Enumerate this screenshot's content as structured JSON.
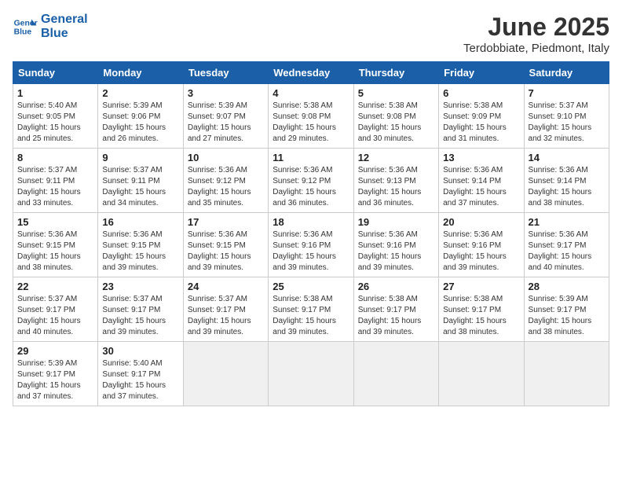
{
  "logo": {
    "line1": "General",
    "line2": "Blue"
  },
  "title": "June 2025",
  "subtitle": "Terdobbiate, Piedmont, Italy",
  "headers": [
    "Sunday",
    "Monday",
    "Tuesday",
    "Wednesday",
    "Thursday",
    "Friday",
    "Saturday"
  ],
  "weeks": [
    [
      {
        "day": "1",
        "sunrise": "Sunrise: 5:40 AM",
        "sunset": "Sunset: 9:05 PM",
        "daylight": "Daylight: 15 hours and 25 minutes."
      },
      {
        "day": "2",
        "sunrise": "Sunrise: 5:39 AM",
        "sunset": "Sunset: 9:06 PM",
        "daylight": "Daylight: 15 hours and 26 minutes."
      },
      {
        "day": "3",
        "sunrise": "Sunrise: 5:39 AM",
        "sunset": "Sunset: 9:07 PM",
        "daylight": "Daylight: 15 hours and 27 minutes."
      },
      {
        "day": "4",
        "sunrise": "Sunrise: 5:38 AM",
        "sunset": "Sunset: 9:08 PM",
        "daylight": "Daylight: 15 hours and 29 minutes."
      },
      {
        "day": "5",
        "sunrise": "Sunrise: 5:38 AM",
        "sunset": "Sunset: 9:08 PM",
        "daylight": "Daylight: 15 hours and 30 minutes."
      },
      {
        "day": "6",
        "sunrise": "Sunrise: 5:38 AM",
        "sunset": "Sunset: 9:09 PM",
        "daylight": "Daylight: 15 hours and 31 minutes."
      },
      {
        "day": "7",
        "sunrise": "Sunrise: 5:37 AM",
        "sunset": "Sunset: 9:10 PM",
        "daylight": "Daylight: 15 hours and 32 minutes."
      }
    ],
    [
      {
        "day": "8",
        "sunrise": "Sunrise: 5:37 AM",
        "sunset": "Sunset: 9:11 PM",
        "daylight": "Daylight: 15 hours and 33 minutes."
      },
      {
        "day": "9",
        "sunrise": "Sunrise: 5:37 AM",
        "sunset": "Sunset: 9:11 PM",
        "daylight": "Daylight: 15 hours and 34 minutes."
      },
      {
        "day": "10",
        "sunrise": "Sunrise: 5:36 AM",
        "sunset": "Sunset: 9:12 PM",
        "daylight": "Daylight: 15 hours and 35 minutes."
      },
      {
        "day": "11",
        "sunrise": "Sunrise: 5:36 AM",
        "sunset": "Sunset: 9:12 PM",
        "daylight": "Daylight: 15 hours and 36 minutes."
      },
      {
        "day": "12",
        "sunrise": "Sunrise: 5:36 AM",
        "sunset": "Sunset: 9:13 PM",
        "daylight": "Daylight: 15 hours and 36 minutes."
      },
      {
        "day": "13",
        "sunrise": "Sunrise: 5:36 AM",
        "sunset": "Sunset: 9:14 PM",
        "daylight": "Daylight: 15 hours and 37 minutes."
      },
      {
        "day": "14",
        "sunrise": "Sunrise: 5:36 AM",
        "sunset": "Sunset: 9:14 PM",
        "daylight": "Daylight: 15 hours and 38 minutes."
      }
    ],
    [
      {
        "day": "15",
        "sunrise": "Sunrise: 5:36 AM",
        "sunset": "Sunset: 9:15 PM",
        "daylight": "Daylight: 15 hours and 38 minutes."
      },
      {
        "day": "16",
        "sunrise": "Sunrise: 5:36 AM",
        "sunset": "Sunset: 9:15 PM",
        "daylight": "Daylight: 15 hours and 39 minutes."
      },
      {
        "day": "17",
        "sunrise": "Sunrise: 5:36 AM",
        "sunset": "Sunset: 9:15 PM",
        "daylight": "Daylight: 15 hours and 39 minutes."
      },
      {
        "day": "18",
        "sunrise": "Sunrise: 5:36 AM",
        "sunset": "Sunset: 9:16 PM",
        "daylight": "Daylight: 15 hours and 39 minutes."
      },
      {
        "day": "19",
        "sunrise": "Sunrise: 5:36 AM",
        "sunset": "Sunset: 9:16 PM",
        "daylight": "Daylight: 15 hours and 39 minutes."
      },
      {
        "day": "20",
        "sunrise": "Sunrise: 5:36 AM",
        "sunset": "Sunset: 9:16 PM",
        "daylight": "Daylight: 15 hours and 39 minutes."
      },
      {
        "day": "21",
        "sunrise": "Sunrise: 5:36 AM",
        "sunset": "Sunset: 9:17 PM",
        "daylight": "Daylight: 15 hours and 40 minutes."
      }
    ],
    [
      {
        "day": "22",
        "sunrise": "Sunrise: 5:37 AM",
        "sunset": "Sunset: 9:17 PM",
        "daylight": "Daylight: 15 hours and 40 minutes."
      },
      {
        "day": "23",
        "sunrise": "Sunrise: 5:37 AM",
        "sunset": "Sunset: 9:17 PM",
        "daylight": "Daylight: 15 hours and 39 minutes."
      },
      {
        "day": "24",
        "sunrise": "Sunrise: 5:37 AM",
        "sunset": "Sunset: 9:17 PM",
        "daylight": "Daylight: 15 hours and 39 minutes."
      },
      {
        "day": "25",
        "sunrise": "Sunrise: 5:38 AM",
        "sunset": "Sunset: 9:17 PM",
        "daylight": "Daylight: 15 hours and 39 minutes."
      },
      {
        "day": "26",
        "sunrise": "Sunrise: 5:38 AM",
        "sunset": "Sunset: 9:17 PM",
        "daylight": "Daylight: 15 hours and 39 minutes."
      },
      {
        "day": "27",
        "sunrise": "Sunrise: 5:38 AM",
        "sunset": "Sunset: 9:17 PM",
        "daylight": "Daylight: 15 hours and 38 minutes."
      },
      {
        "day": "28",
        "sunrise": "Sunrise: 5:39 AM",
        "sunset": "Sunset: 9:17 PM",
        "daylight": "Daylight: 15 hours and 38 minutes."
      }
    ],
    [
      {
        "day": "29",
        "sunrise": "Sunrise: 5:39 AM",
        "sunset": "Sunset: 9:17 PM",
        "daylight": "Daylight: 15 hours and 37 minutes."
      },
      {
        "day": "30",
        "sunrise": "Sunrise: 5:40 AM",
        "sunset": "Sunset: 9:17 PM",
        "daylight": "Daylight: 15 hours and 37 minutes."
      },
      null,
      null,
      null,
      null,
      null
    ]
  ]
}
